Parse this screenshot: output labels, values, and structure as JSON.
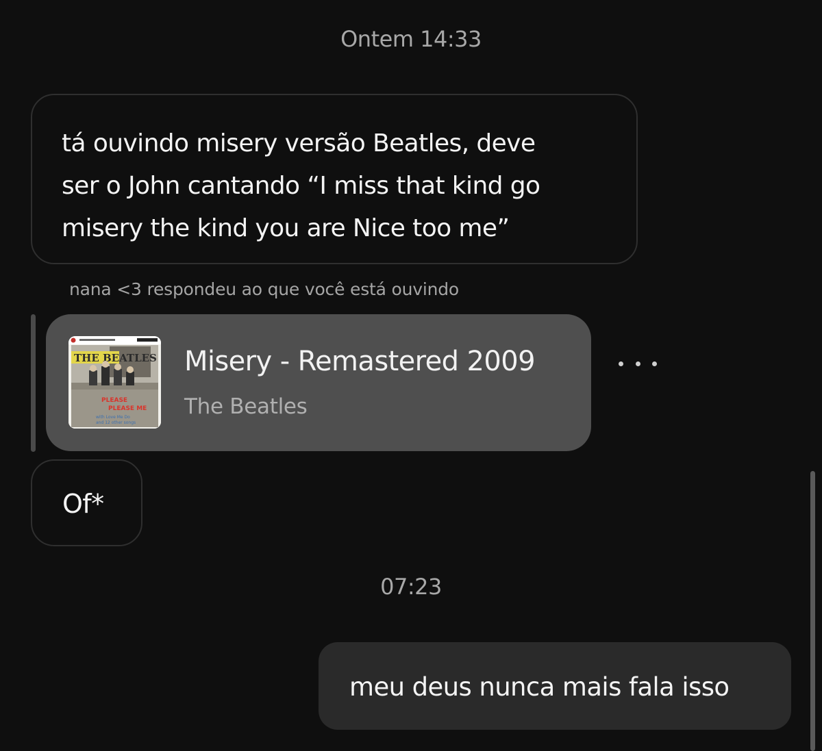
{
  "timestamps": {
    "first": "Ontem 14:33",
    "second": "07:23"
  },
  "messages": [
    {
      "direction": "incoming",
      "text": "tá ouvindo misery versão Beatles, deve\nser o John cantando “I miss that kind go\nmisery the kind you are Nice too me”"
    },
    {
      "direction": "incoming",
      "text": "Of*"
    },
    {
      "direction": "outgoing",
      "text": "meu deus nunca mais fala isso"
    }
  ],
  "reply_note": "nana <3 respondeu ao que você está ouvindo",
  "track": {
    "title": "Misery - Remastered 2009",
    "artist": "The Beatles",
    "album_art_icon": "album-cover-please-please-me"
  },
  "colors": {
    "background": "#0f0f0f",
    "incoming_border": "#2f2f2f",
    "outgoing_bubble": "#2a2a2a",
    "track_card": "#4f4f4f",
    "secondary_text": "#a8a8a8"
  }
}
